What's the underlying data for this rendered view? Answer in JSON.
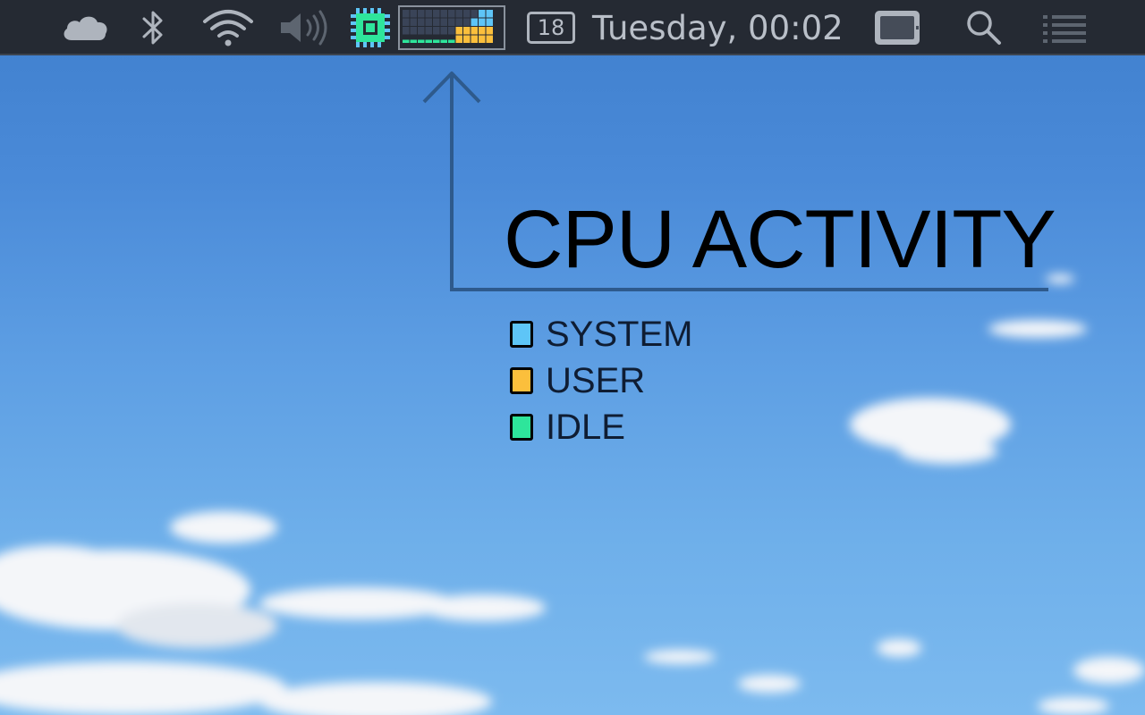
{
  "menubar": {
    "icons": [
      "cloud-icon",
      "bluetooth-icon",
      "wifi-icon",
      "volume-icon",
      "cpu-chip-icon",
      "cpu-activity-graph",
      "calendar-icon",
      "display-icon",
      "search-icon",
      "list-icon"
    ],
    "calendar_day": "18",
    "datetime": "Tuesday, 00:02",
    "cpu_graph": {
      "columns": 12,
      "rows": 4,
      "levels": [
        {
          "system": 0,
          "user": 0,
          "idle": 1
        },
        {
          "system": 0,
          "user": 0,
          "idle": 1
        },
        {
          "system": 0,
          "user": 0,
          "idle": 1
        },
        {
          "system": 0,
          "user": 0,
          "idle": 1
        },
        {
          "system": 0,
          "user": 0,
          "idle": 1
        },
        {
          "system": 0,
          "user": 0,
          "idle": 1
        },
        {
          "system": 0,
          "user": 0,
          "idle": 1
        },
        {
          "system": 0,
          "user": 2,
          "idle": 0
        },
        {
          "system": 0,
          "user": 2,
          "idle": 0
        },
        {
          "system": 1,
          "user": 2,
          "idle": 0
        },
        {
          "system": 2,
          "user": 2,
          "idle": 0
        },
        {
          "system": 2,
          "user": 2,
          "idle": 0
        }
      ]
    }
  },
  "annotation": {
    "title": "CPU ACTIVITY",
    "legend": [
      {
        "label": "SYSTEM",
        "color": "#5ec5f7"
      },
      {
        "label": "USER",
        "color": "#fbbf3c"
      },
      {
        "label": "IDLE",
        "color": "#2ee59b"
      }
    ]
  },
  "colors": {
    "menubar_bg": "#252a33",
    "icon_gray": "#aeb4bd",
    "system": "#5ec5f7",
    "user": "#fbbf3c",
    "idle": "#2ee59b",
    "arrow": "#2e5a8c"
  }
}
